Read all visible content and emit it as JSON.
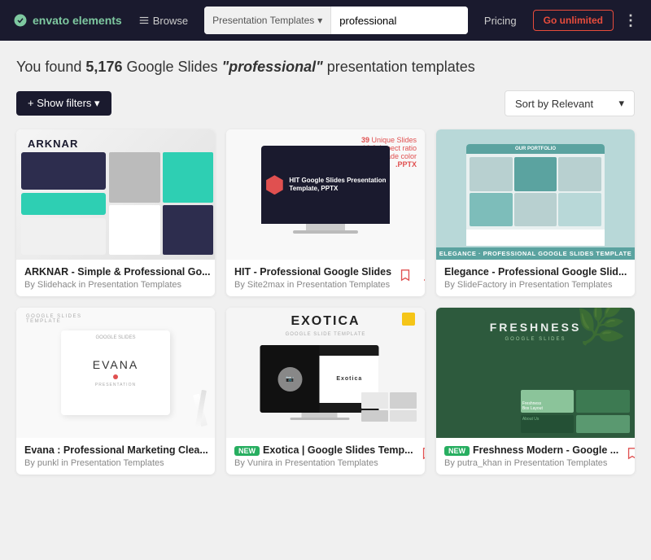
{
  "header": {
    "logo": "envato elements",
    "browse_label": "Browse",
    "search_category": "Presentation Templates",
    "search_value": "professional",
    "pricing_label": "Pricing",
    "go_unlimited_label": "Go unlimited"
  },
  "results": {
    "count": "5,176",
    "type": "Google Slides",
    "query": "\"professional\"",
    "suffix": "presentation templates"
  },
  "filters": {
    "show_filters_label": "+ Show filters ▾",
    "sort_label": "Sort by Relevant"
  },
  "cards": [
    {
      "id": "arknar",
      "title": "ARKNAR - Simple & Professional Go...",
      "author": "By Slidehack in Presentation Templates",
      "is_new": false
    },
    {
      "id": "hit",
      "title": "HIT - Professional Google Slides",
      "author": "By Site2max in Presentation Templates",
      "is_new": false
    },
    {
      "id": "elegance",
      "title": "Elegance - Professional Google Slid...",
      "author": "By SlideFactory in Presentation Templates",
      "is_new": false
    },
    {
      "id": "evana",
      "title": "Evana : Professional Marketing Clea...",
      "author": "By punkl in Presentation Templates",
      "is_new": false
    },
    {
      "id": "exotica",
      "title": "Exotica | Google Slides Temp...",
      "author": "By Vunira in Presentation Templates",
      "is_new": true
    },
    {
      "id": "freshness",
      "title": "Freshness Modern - Google ...",
      "author": "By putra_khan in Presentation Templates",
      "is_new": true
    }
  ]
}
